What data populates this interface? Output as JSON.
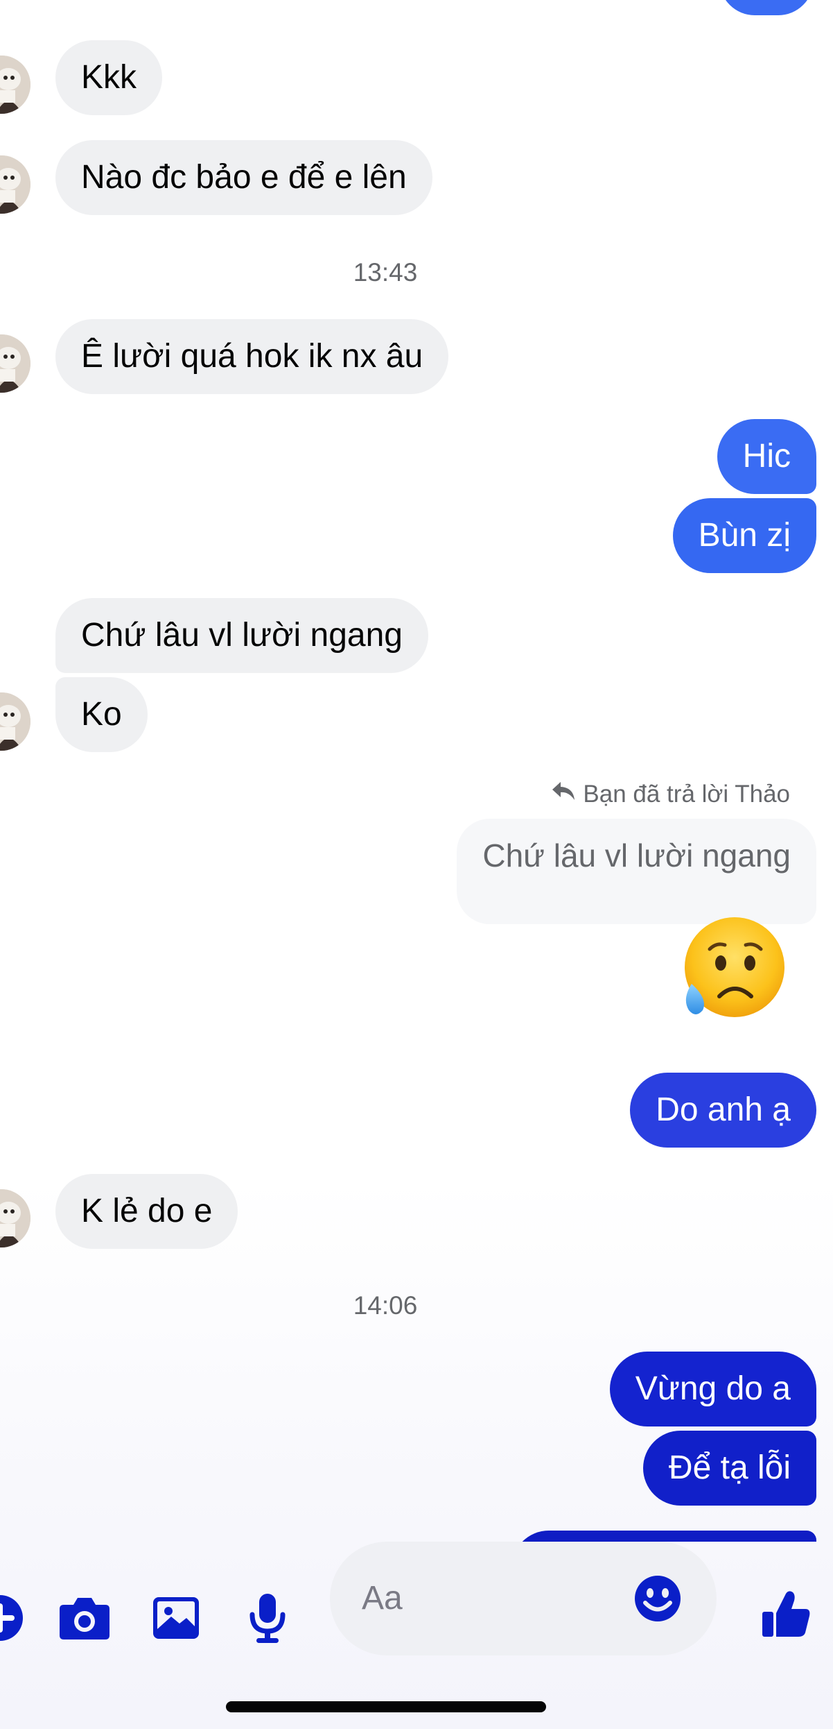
{
  "theme": {
    "incoming_bubble": "#eff0f2",
    "outgoing_gradient": [
      "#3a6cf3",
      "#2a3fe0",
      "#1120c9"
    ],
    "composer_icon": "#0a1fc8",
    "timestamp_text": "#65676b"
  },
  "messages": [
    {
      "text": "Kkk"
    },
    {
      "text": "Nào đc bảo e để e lên"
    },
    {
      "text": "Ê lười quá hok ik nx âu"
    },
    {
      "text": "Hic"
    },
    {
      "text": "Bùn zị"
    },
    {
      "text": "Chứ lâu vl lười ngang"
    },
    {
      "text": "Ko"
    },
    {
      "text": "Do anh ạ"
    },
    {
      "text": "K lẻ do e"
    },
    {
      "text": "Vừng do a"
    },
    {
      "text": "Để tạ lỗi"
    }
  ],
  "timestamps": [
    "13:43",
    "14:06"
  ],
  "reply": {
    "label": "Bạn đã trả lời Thảo",
    "quoted_text": "Chứ lâu vl lười ngang",
    "reaction_emoji": "sad-but-relieved-face"
  },
  "composer": {
    "placeholder": "Aa",
    "icons": [
      "plus-icon",
      "camera-icon",
      "image-icon",
      "microphone-icon",
      "emoji-icon",
      "thumbs-up-icon"
    ]
  }
}
